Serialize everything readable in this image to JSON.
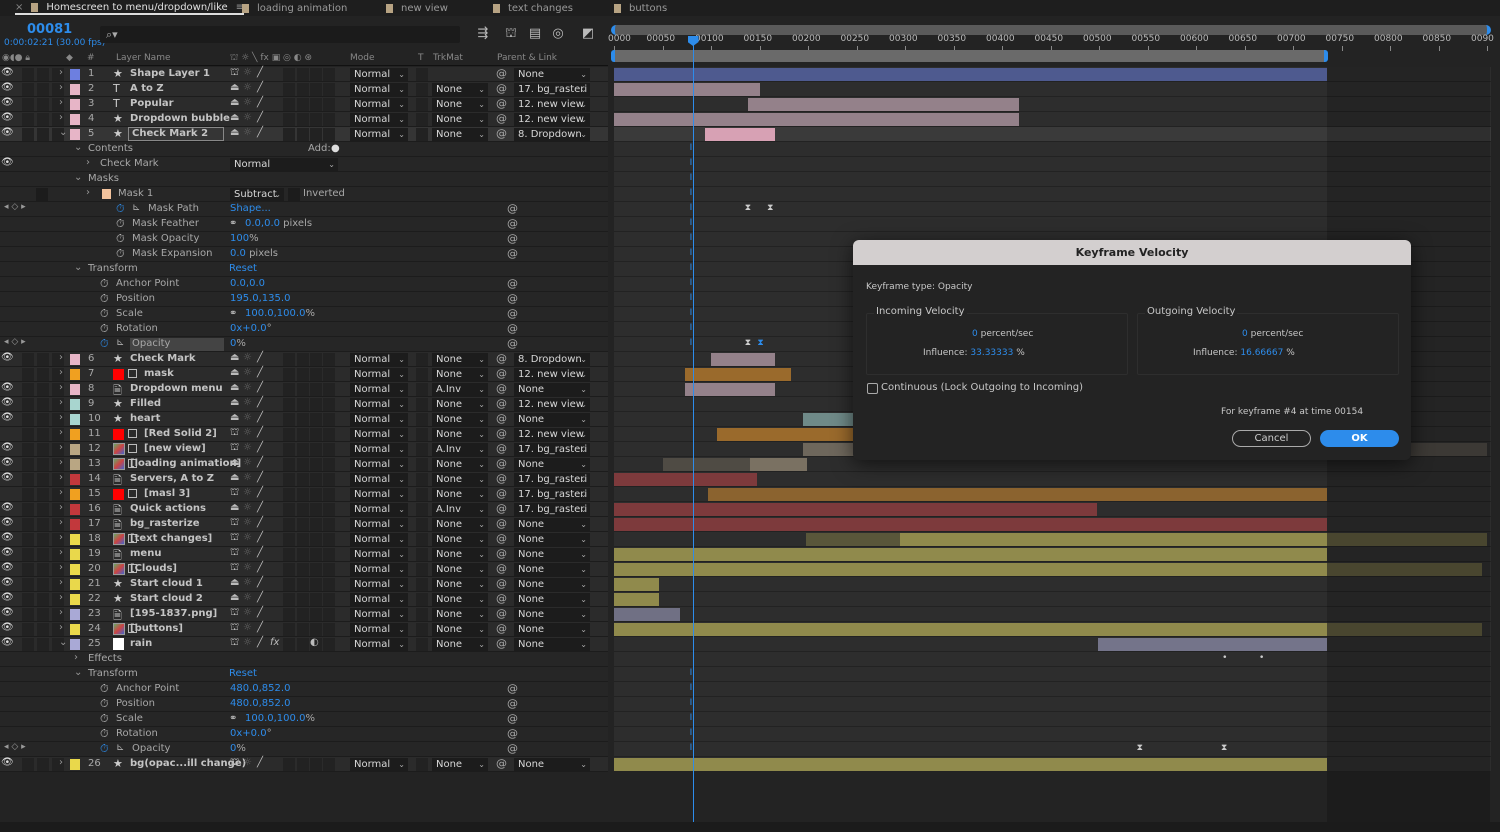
{
  "tabs": [
    {
      "label": "Homescreen to menu/dropdown/like",
      "active": true
    },
    {
      "label": "loading animation"
    },
    {
      "label": "new view"
    },
    {
      "label": "text changes"
    },
    {
      "label": "buttons"
    }
  ],
  "tab_close": "×",
  "tab_menu": "≡",
  "timecode": "00081",
  "time_sub": "0:00:02:21 (30.00 fps)",
  "search_placeholder": "⌕▾",
  "columns": {
    "layer_name": "Layer Name",
    "num": "#",
    "mode": "Mode",
    "t": "T",
    "trkmat": "TrkMat",
    "parent": "Parent & Link"
  },
  "ruler": [
    "0000",
    "00050",
    "00100",
    "00150",
    "00200",
    "00250",
    "00300",
    "00350",
    "00400",
    "00450",
    "00500",
    "00550",
    "00600",
    "00650",
    "00700",
    "00750",
    "00800",
    "00850",
    "0090"
  ],
  "current_frame": 81,
  "work_area_end": 735,
  "colors": {
    "accent": "#2d8ceb",
    "blue": "#6d7fe0",
    "pink": "#e7b5c7",
    "orange": "#f0a020",
    "teal": "#a8d5cf",
    "tan": "#b9a683",
    "red": "#c2383c",
    "yellow": "#e9d84b",
    "lavender": "#a9a9d6",
    "white": "#ffffff",
    "peach": "#f3c39d"
  },
  "rows": [
    {
      "t": "layer",
      "n": "1",
      "name": "Shape Layer 1",
      "icon": "star",
      "color": "blue",
      "mode": "Normal",
      "trk": "",
      "parent": "None",
      "eye": true,
      "sw": "3d",
      "bar": {
        "c": "#4e5a8f",
        "s": 0,
        "e": 735
      }
    },
    {
      "t": "layer",
      "n": "2",
      "name": "A to Z",
      "icon": "text",
      "color": "pink",
      "mode": "Normal",
      "trk": "None",
      "parent": "17. bg_rasteri",
      "eye": true,
      "bar": {
        "c": "#94818a",
        "s": 0,
        "e": 150
      }
    },
    {
      "t": "layer",
      "n": "3",
      "name": "Popular",
      "icon": "text",
      "color": "pink",
      "mode": "Normal",
      "trk": "None",
      "parent": "12. new view",
      "eye": true,
      "bar": {
        "c": "#94818a",
        "s": 138,
        "e": 418
      }
    },
    {
      "t": "layer",
      "n": "4",
      "name": "Dropdown bubble",
      "icon": "star",
      "color": "pink",
      "mode": "Normal",
      "trk": "None",
      "parent": "12. new view",
      "eye": true,
      "bar": {
        "c": "#94818a",
        "s": 0,
        "e": 418
      }
    },
    {
      "t": "layer",
      "n": "5",
      "name": "Check Mark 2",
      "icon": "star",
      "color": "pink",
      "mode": "Normal",
      "trk": "None",
      "parent": "8. Dropdown",
      "eye": true,
      "open": true,
      "sel": true,
      "bar": {
        "c": "#d7a1b4",
        "s": 94,
        "e": 166
      }
    },
    {
      "t": "group",
      "ind": 78,
      "label": "Contents",
      "open": true,
      "add": "Add:"
    },
    {
      "t": "group",
      "ind": 90,
      "label": "Check Mark",
      "open": false,
      "eye": true,
      "blend": "Normal"
    },
    {
      "t": "group",
      "ind": 78,
      "label": "Masks",
      "open": true
    },
    {
      "t": "mask",
      "ind": 90,
      "label": "Mask 1",
      "maskmode": "Subtract",
      "inverted": "Inverted"
    },
    {
      "t": "prop",
      "ind": 116,
      "label": "Mask Path",
      "value": "Shape...",
      "unit": "",
      "anim": true,
      "graph": true,
      "kfnav": true,
      "kfs": [
        141,
        164
      ]
    },
    {
      "t": "prop",
      "ind": 116,
      "label": "Mask Feather",
      "link": true,
      "value": "0.0,0.0",
      "unit": " pixels"
    },
    {
      "t": "prop",
      "ind": 116,
      "label": "Mask Opacity",
      "value": "100",
      "unit": "%"
    },
    {
      "t": "prop",
      "ind": 116,
      "label": "Mask Expansion",
      "value": "0.0",
      "unit": " pixels"
    },
    {
      "t": "group",
      "ind": 78,
      "label": "Transform",
      "open": true,
      "reset": "Reset"
    },
    {
      "t": "prop",
      "ind": 100,
      "label": "Anchor Point",
      "value": "0.0,0.0",
      "unit": ""
    },
    {
      "t": "prop",
      "ind": 100,
      "label": "Position",
      "value": "195.0,135.0",
      "unit": ""
    },
    {
      "t": "prop",
      "ind": 100,
      "label": "Scale",
      "link": true,
      "value": "100.0,100.0",
      "unit": "%"
    },
    {
      "t": "prop",
      "ind": 100,
      "label": "Rotation",
      "value": "0x+0.0",
      "unit": "°"
    },
    {
      "t": "prop",
      "ind": 100,
      "label": "Opacity",
      "value": "0",
      "unit": "%",
      "anim": true,
      "graph": true,
      "kfnav": true,
      "hl": true,
      "kfs": [
        141,
        154
      ]
    },
    {
      "t": "layer",
      "n": "6",
      "name": "Check Mark",
      "icon": "star",
      "color": "pink",
      "mode": "Normal",
      "trk": "None",
      "parent": "8. Dropdown",
      "eye": true,
      "bar": {
        "c": "#94818a",
        "s": 100,
        "e": 166
      }
    },
    {
      "t": "layer",
      "n": "7",
      "name": "mask",
      "icon": "solid",
      "color": "orange",
      "mode": "Normal",
      "trk": "None",
      "parent": "12. new view",
      "eye": false,
      "bar": {
        "c": "#9a6a2c",
        "s": 73,
        "e": 183
      }
    },
    {
      "t": "layer",
      "n": "8",
      "name": "Dropdown menu",
      "icon": "file",
      "color": "pink",
      "mode": "Normal",
      "trk": "A.Inv",
      "parent": "None",
      "eye": true,
      "bar": {
        "c": "#94818a",
        "s": 73,
        "e": 166
      }
    },
    {
      "t": "layer",
      "n": "9",
      "name": "Filled",
      "icon": "star",
      "color": "teal",
      "mode": "Normal",
      "trk": "None",
      "parent": "12. new view",
      "eye": true
    },
    {
      "t": "layer",
      "n": "10",
      "name": "heart",
      "icon": "star",
      "color": "teal",
      "mode": "Normal",
      "trk": "None",
      "parent": "None",
      "eye": true,
      "bar": {
        "c": "#6f8a88",
        "s": 195,
        "e": 300
      }
    },
    {
      "t": "layer",
      "n": "11",
      "name": "[Red Solid 2]",
      "icon": "solid",
      "color": "orange",
      "mode": "Normal",
      "trk": "None",
      "parent": "12. new view",
      "eye": false,
      "sw": "3d",
      "bar": {
        "c": "#9a6a2c",
        "s": 106,
        "e": 300
      }
    },
    {
      "t": "layer",
      "n": "12",
      "name": "[new view]",
      "icon": "comp",
      "color": "tan",
      "mode": "Normal",
      "trk": "A.Inv",
      "parent": "17. bg_rasteri",
      "eye": true,
      "sw": "3d",
      "bar": {
        "c": "#6e675c",
        "s": 195,
        "e": 900
      }
    },
    {
      "t": "layer",
      "n": "13",
      "name": "[loading animation]",
      "icon": "comp",
      "color": "tan",
      "mode": "Normal",
      "trk": "None",
      "parent": "None",
      "eye": true,
      "bar": {
        "c": "#7a7162",
        "s": 140,
        "e": 199,
        "dim": 50
      }
    },
    {
      "t": "layer",
      "n": "14",
      "name": "Servers, A to Z",
      "icon": "file",
      "color": "red",
      "mode": "Normal",
      "trk": "None",
      "parent": "17. bg_rasteri",
      "eye": true,
      "bar": {
        "c": "#7d3a3c",
        "s": 0,
        "e": 147
      }
    },
    {
      "t": "layer",
      "n": "15",
      "name": "[masl 3]",
      "icon": "solid",
      "color": "orange",
      "mode": "Normal",
      "trk": "None",
      "parent": "17. bg_rasteri",
      "eye": false,
      "sw": "3d",
      "bar": {
        "c": "#8b632f",
        "s": 97,
        "e": 735
      }
    },
    {
      "t": "layer",
      "n": "16",
      "name": "Quick actions",
      "icon": "file",
      "color": "red",
      "mode": "Normal",
      "trk": "A.Inv",
      "parent": "17. bg_rasteri",
      "eye": true,
      "bar": {
        "c": "#7d3a3c",
        "s": 0,
        "e": 498
      }
    },
    {
      "t": "layer",
      "n": "17",
      "name": "bg_rasterize",
      "icon": "file",
      "color": "red",
      "mode": "Normal",
      "trk": "None",
      "parent": "None",
      "eye": true,
      "sw": "3d",
      "bar": {
        "c": "#7d3a3c",
        "s": 0,
        "e": 735
      }
    },
    {
      "t": "layer",
      "n": "18",
      "name": "[text changes]",
      "icon": "comp",
      "color": "yellow",
      "mode": "Normal",
      "trk": "None",
      "parent": "None",
      "eye": true,
      "sw": "3d",
      "bar": {
        "c": "#908a4c",
        "s": 295,
        "e": 900,
        "dim": 198
      }
    },
    {
      "t": "layer",
      "n": "19",
      "name": "menu",
      "icon": "file",
      "color": "yellow",
      "mode": "Normal",
      "trk": "None",
      "parent": "None",
      "eye": true,
      "sw": "3d",
      "bar": {
        "c": "#908a4c",
        "s": 0,
        "e": 735
      }
    },
    {
      "t": "layer",
      "n": "20",
      "name": "[Clouds]",
      "icon": "comp",
      "color": "yellow",
      "mode": "Normal",
      "trk": "None",
      "parent": "None",
      "eye": true,
      "sw": "3d",
      "bar": {
        "c": "#908a4c",
        "s": 0,
        "e": 895
      }
    },
    {
      "t": "layer",
      "n": "21",
      "name": "Start cloud 1",
      "icon": "star",
      "color": "yellow",
      "mode": "Normal",
      "trk": "None",
      "parent": "None",
      "eye": true,
      "bar": {
        "c": "#908a4c",
        "s": 0,
        "e": 46
      }
    },
    {
      "t": "layer",
      "n": "22",
      "name": "Start cloud 2",
      "icon": "star",
      "color": "yellow",
      "mode": "Normal",
      "trk": "None",
      "parent": "None",
      "eye": true,
      "bar": {
        "c": "#908a4c",
        "s": 0,
        "e": 46
      }
    },
    {
      "t": "layer",
      "n": "23",
      "name": "[195-1837.png]",
      "icon": "file",
      "color": "lavender",
      "mode": "Normal",
      "trk": "None",
      "parent": "None",
      "eye": true,
      "sw": "3d",
      "bar": {
        "c": "#707084",
        "s": 0,
        "e": 68
      }
    },
    {
      "t": "layer",
      "n": "24",
      "name": "[buttons]",
      "icon": "comp",
      "color": "yellow",
      "mode": "Normal",
      "trk": "None",
      "parent": "None",
      "eye": true,
      "sw": "3d",
      "bar": {
        "c": "#908a4c",
        "s": 0,
        "e": 895
      }
    },
    {
      "t": "layer",
      "n": "25",
      "name": "rain",
      "icon": "white",
      "color": "lavender",
      "mode": "Normal",
      "trk": "None",
      "parent": "None",
      "eye": true,
      "open": true,
      "sw": "3d",
      "fx": true,
      "bar": {
        "c": "#74748a",
        "s": 499,
        "e": 735
      }
    },
    {
      "t": "group",
      "ind": 78,
      "label": "Effects",
      "open": false,
      "kfs": [
        629,
        667
      ],
      "dots": true
    },
    {
      "t": "group",
      "ind": 78,
      "label": "Transform",
      "open": true,
      "reset": "Reset"
    },
    {
      "t": "prop",
      "ind": 100,
      "label": "Anchor Point",
      "value": "480.0,852.0",
      "unit": ""
    },
    {
      "t": "prop",
      "ind": 100,
      "label": "Position",
      "value": "480.0,852.0",
      "unit": ""
    },
    {
      "t": "prop",
      "ind": 100,
      "label": "Scale",
      "link": true,
      "value": "100.0,100.0",
      "unit": "%"
    },
    {
      "t": "prop",
      "ind": 100,
      "label": "Rotation",
      "value": "0x+0.0",
      "unit": "°"
    },
    {
      "t": "prop",
      "ind": 100,
      "label": "Opacity",
      "value": "0",
      "unit": "%",
      "anim": true,
      "graph": true,
      "kfnav": true,
      "kfs": [
        545,
        632
      ]
    },
    {
      "t": "layer",
      "n": "26",
      "name": "bg(opac...ill change)",
      "icon": "star",
      "color": "yellow",
      "mode": "Normal",
      "trk": "None",
      "parent": "None",
      "eye": true,
      "sw": "3d",
      "bar": {
        "c": "#908a4c",
        "s": 0,
        "e": 735
      }
    }
  ],
  "dialog": {
    "title": "Keyframe Velocity",
    "type": "Keyframe type: Opacity",
    "incoming": {
      "title": "Incoming Velocity",
      "velocity": "0",
      "unit": "percent/sec",
      "influence_label": "Influence:",
      "influence": "33.33333",
      "pct": "%"
    },
    "outgoing": {
      "title": "Outgoing Velocity",
      "velocity": "0",
      "unit": "percent/sec",
      "influence_label": "Influence:",
      "influence": "16.66667",
      "pct": "%"
    },
    "continuous": "Continuous (Lock Outgoing to Incoming)",
    "continuous_checked": false,
    "info": "For keyframe #4 at time 00154",
    "cancel": "Cancel",
    "ok": "OK"
  }
}
